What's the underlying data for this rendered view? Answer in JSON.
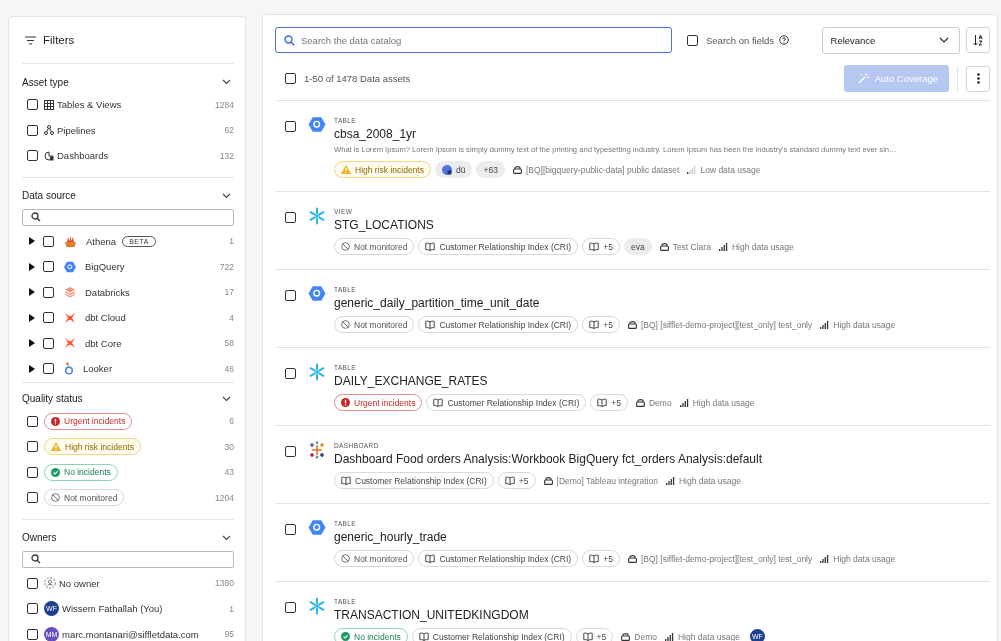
{
  "filters": {
    "title": "Filters",
    "sections": [
      {
        "title": "Asset type",
        "expanded": true,
        "kind": "plain",
        "items": [
          {
            "kind": "type",
            "label": "Tables & Views",
            "count": "1284",
            "checked": false
          },
          {
            "kind": "type",
            "label": "Pipelines",
            "count": "62",
            "checked": false
          },
          {
            "kind": "type",
            "label": "Dashboards",
            "count": "132",
            "checked": false
          }
        ]
      },
      {
        "title": "Data source",
        "expanded": true,
        "kind": "searchable",
        "items": [
          {
            "kind": "source",
            "label": "Athena",
            "badge": "BETA",
            "count": "1",
            "checked": false,
            "expanded": false
          },
          {
            "kind": "source",
            "label": "BigQuery",
            "count": "722",
            "checked": false,
            "expanded": false
          },
          {
            "kind": "source",
            "label": "Databricks",
            "count": "17",
            "checked": false,
            "expanded": false
          },
          {
            "kind": "source",
            "label": "dbt Cloud",
            "count": "4",
            "checked": false,
            "expanded": false
          },
          {
            "kind": "source",
            "label": "dbt Core",
            "count": "58",
            "checked": false,
            "expanded": false
          },
          {
            "kind": "source",
            "label": "Looker",
            "count": "46",
            "checked": false,
            "expanded": false
          }
        ]
      },
      {
        "title": "Quality status",
        "expanded": true,
        "kind": "plain",
        "items": [
          {
            "kind": "urgent",
            "label": "Urgent incidents",
            "count": "6",
            "checked": false
          },
          {
            "kind": "high_risk",
            "label": "High risk incidents",
            "count": "30",
            "checked": false
          },
          {
            "kind": "ok",
            "label": "No incidents",
            "count": "43",
            "checked": false
          },
          {
            "kind": "not_monitored",
            "label": "Not monitored",
            "count": "1204",
            "checked": false
          }
        ]
      },
      {
        "title": "Owners",
        "expanded": true,
        "kind": "searchable",
        "items": [
          {
            "kind": "owner",
            "label": "No owner",
            "count": "1380",
            "checked": false
          },
          {
            "kind": "owner",
            "label": "Wissem Fathallah (You)",
            "initials": "WF",
            "color": "#1f3f8f",
            "count": "1",
            "checked": false
          },
          {
            "kind": "owner",
            "label": "marc.montanari@siffletdata.com",
            "initials": "MM",
            "color": "#6a4fc4",
            "count": "95",
            "checked": false
          }
        ]
      }
    ]
  },
  "main": {
    "search": {
      "placeholder": "Search the data catalog",
      "focused": true
    },
    "search_on_fields": {
      "label": "Search on fields",
      "checked": false
    },
    "sort": {
      "value": "Relevance"
    },
    "results": {
      "label": "1-50 of 1478 Data assets",
      "checked": false
    },
    "auto_coverage": {
      "label": "Auto Coverage",
      "disabled": true
    },
    "assets": [
      {
        "type": "TABLE",
        "name": "cbsa_2008_1yr",
        "description": "What is Lorem Ipsum? Lorem Ipsum is simply dummy text of the printing and typesetting industry. Lorem Ipsum has been the industry's standard dummy text ever sin…",
        "checked": false,
        "tags": [
          {
            "kind": "high_risk",
            "label": "High risk incidents"
          },
          {
            "kind": "owner",
            "label": "dü"
          },
          {
            "kind": "count",
            "label": "+63"
          },
          {
            "kind": "dataset",
            "label": "[BQ][bigquery-public-data] public dataset"
          },
          {
            "kind": "usage",
            "high": false,
            "label": "Low data usage"
          }
        ]
      },
      {
        "type": "VIEW",
        "name": "STG_LOCATIONS",
        "checked": false,
        "tags": [
          {
            "kind": "not_monitored",
            "label": "Not monitored"
          },
          {
            "kind": "term",
            "label": "Customer Relationship Index (CRI)"
          },
          {
            "kind": "term",
            "label": "+5"
          },
          {
            "kind": "tag",
            "label": "eva"
          },
          {
            "kind": "dataset",
            "label": "Test Clara"
          },
          {
            "kind": "usage",
            "high": true,
            "label": "High data usage"
          }
        ]
      },
      {
        "type": "TABLE",
        "name": "generic_daily_partition_time_unit_date",
        "checked": false,
        "tags": [
          {
            "kind": "not_monitored",
            "label": "Not monitored"
          },
          {
            "kind": "term",
            "label": "Customer Relationship Index (CRI)"
          },
          {
            "kind": "term",
            "label": "+5"
          },
          {
            "kind": "dataset",
            "label": "[BQ] [sifflet-demo-project][test_only] test_only"
          },
          {
            "kind": "usage",
            "high": true,
            "label": "High data usage"
          }
        ]
      },
      {
        "type": "TABLE",
        "name": "DAILY_EXCHANGE_RATES",
        "checked": false,
        "tags": [
          {
            "kind": "urgent",
            "label": "Urgent incidents"
          },
          {
            "kind": "term",
            "label": "Customer Relationship Index (CRI)"
          },
          {
            "kind": "term",
            "label": "+5"
          },
          {
            "kind": "dataset",
            "label": "Demo"
          },
          {
            "kind": "usage",
            "high": true,
            "label": "High data usage"
          }
        ]
      },
      {
        "type": "DASHBOARD",
        "name": "Dashboard Food orders Analysis:Workbook BigQuery fct_orders Analysis:default",
        "checked": false,
        "tags": [
          {
            "kind": "term",
            "label": "Customer Relationship Index (CRI)"
          },
          {
            "kind": "term",
            "label": "+5"
          },
          {
            "kind": "dataset",
            "label": "[Demo] Tableau integration"
          },
          {
            "kind": "usage",
            "high": true,
            "label": "High data usage"
          }
        ]
      },
      {
        "type": "TABLE",
        "name": "generic_hourly_trade",
        "checked": false,
        "tags": [
          {
            "kind": "not_monitored",
            "label": "Not monitored"
          },
          {
            "kind": "term",
            "label": "Customer Relationship Index (CRI)"
          },
          {
            "kind": "term",
            "label": "+5"
          },
          {
            "kind": "dataset",
            "label": "[BQ] [sifflet-demo-project][test_only] test_only"
          },
          {
            "kind": "usage",
            "high": true,
            "label": "High data usage"
          }
        ]
      },
      {
        "type": "TABLE",
        "name": "TRANSACTION_UNITEDKINGDOM",
        "checked": false,
        "tags": [
          {
            "kind": "ok",
            "label": "No incidents"
          },
          {
            "kind": "term",
            "label": "Customer Relationship Index (CRI)"
          },
          {
            "kind": "term",
            "label": "+5"
          },
          {
            "kind": "dataset",
            "label": "Demo"
          },
          {
            "kind": "usage",
            "high": true,
            "label": "High data usage"
          },
          {
            "kind": "avatar",
            "initials": "WF",
            "color": "#1f3f8f"
          }
        ]
      }
    ]
  }
}
